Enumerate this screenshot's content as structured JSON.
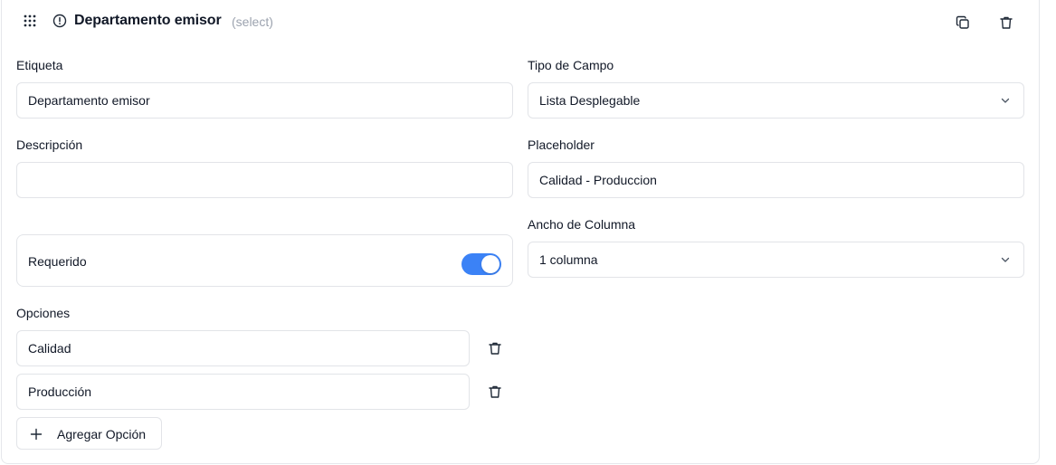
{
  "header": {
    "title": "Departamento emisor",
    "type_tag": "(select)",
    "icons": [
      "drag-handle-icon",
      "info-circle-icon",
      "copy-icon",
      "trash-icon"
    ]
  },
  "fields": {
    "etiqueta": {
      "label": "Etiqueta",
      "value": "Departamento emisor"
    },
    "tipo_campo": {
      "label": "Tipo de Campo",
      "value": "Lista Desplegable"
    },
    "descripcion": {
      "label": "Descripción",
      "value": ""
    },
    "placeholder": {
      "label": "Placeholder",
      "value": "Calidad - Produccion"
    },
    "ancho_columna": {
      "label": "Ancho de Columna",
      "value": "1 columna"
    },
    "requerido": {
      "label": "Requerido",
      "enabled": true
    }
  },
  "opciones": {
    "label": "Opciones",
    "items": [
      {
        "value": "Calidad"
      },
      {
        "value": "Producción"
      }
    ],
    "add_label": "Agregar Opción"
  },
  "colors": {
    "toggle_on": "#3b82f6",
    "border": "#e2e4e8",
    "muted_text": "#9ca3af"
  }
}
